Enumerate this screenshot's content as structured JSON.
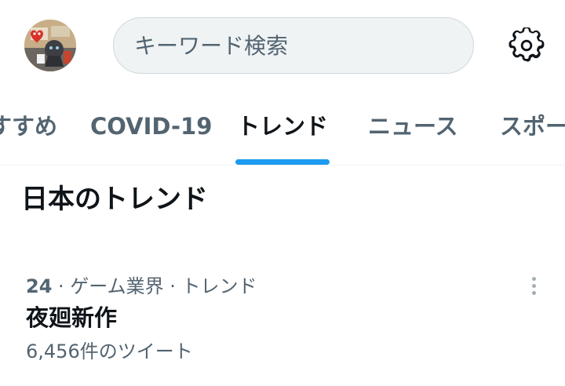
{
  "header": {
    "search_placeholder": "キーワード検索"
  },
  "tabs": [
    {
      "label": "すすめ",
      "active": false
    },
    {
      "label": "COVID-19",
      "active": false
    },
    {
      "label": "トレンド",
      "active": true
    },
    {
      "label": "ニュース",
      "active": false
    },
    {
      "label": "スポー",
      "active": false
    }
  ],
  "section": {
    "title": "日本のトレンド"
  },
  "trends": [
    {
      "rank": "24",
      "separator1": " · ",
      "category": "ゲーム業界",
      "separator2": " · ",
      "type": "トレンド",
      "name": "夜廻新作",
      "count": "6,456件のツイート"
    }
  ],
  "colors": {
    "accent": "#1d9bf0",
    "text_primary": "#0f1419",
    "text_secondary": "#536471"
  }
}
